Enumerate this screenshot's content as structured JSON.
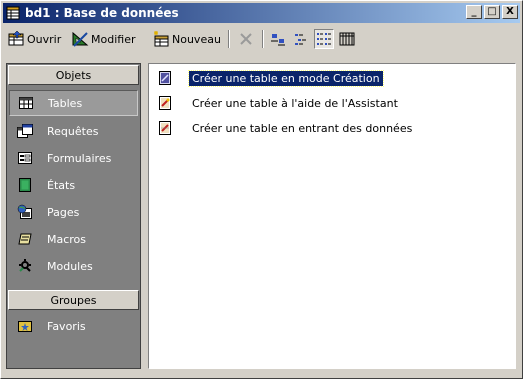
{
  "window": {
    "title": "bd1 : Base de données",
    "minimize_glyph": "_",
    "restore_glyph": "□",
    "close_glyph": "X"
  },
  "toolbar": {
    "open_label": "Ouvrir",
    "modify_label": "Modifier",
    "new_label": "Nouveau"
  },
  "objects_bar": {
    "header": "Objets",
    "items": [
      {
        "label": "Tables",
        "icon": "table-icon",
        "selected": true
      },
      {
        "label": "Requêtes",
        "icon": "query-icon"
      },
      {
        "label": "Formulaires",
        "icon": "form-icon"
      },
      {
        "label": "États",
        "icon": "report-icon"
      },
      {
        "label": "Pages",
        "icon": "page-icon"
      },
      {
        "label": "Macros",
        "icon": "macro-icon"
      },
      {
        "label": "Modules",
        "icon": "module-icon"
      }
    ],
    "groups_header": "Groupes",
    "groups": [
      {
        "label": "Favoris",
        "icon": "favorites-folder-icon"
      }
    ]
  },
  "list": {
    "items": [
      {
        "label": "Créer une table en mode Création",
        "selected": true
      },
      {
        "label": "Créer une table à l'aide de l'Assistant"
      },
      {
        "label": "Créer une table en entrant des données"
      }
    ]
  },
  "colors": {
    "title_gradient_start": "#0a246a",
    "title_gradient_end": "#a6caf0",
    "objects_bar_bg": "#808080",
    "selection": "#0a246a"
  }
}
